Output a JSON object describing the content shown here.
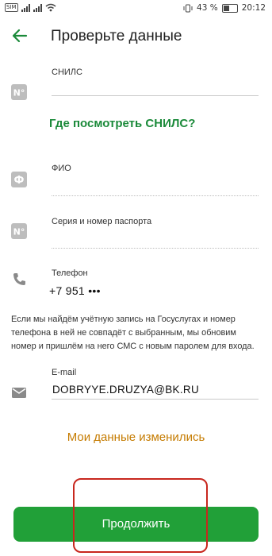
{
  "status_bar": {
    "sim_label": "SIM",
    "battery": "43 %",
    "time": "20:12"
  },
  "header": {
    "title": "Проверьте данные",
    "back_icon": "arrow-left-icon"
  },
  "fields": {
    "snils": {
      "label": "СНИЛС",
      "value": "",
      "icon": "number-sign-icon"
    },
    "fio": {
      "label": "ФИО",
      "value": "",
      "icon": "fio-icon"
    },
    "passport": {
      "label": "Серия и номер паспорта",
      "value": "",
      "icon": "number-sign-icon"
    },
    "phone": {
      "label": "Телефон",
      "value": "+7 951 •••",
      "icon": "phone-icon"
    },
    "email": {
      "label": "E-mail",
      "value": "DOBRYYE.DRUZYA@BK.RU",
      "icon": "mail-icon"
    }
  },
  "where_snils_link": "Где посмотреть СНИЛС?",
  "notice_text": "Если мы найдём учётную запись на Госуслугах и номер телефона в ней не совпадёт с выбранным, мы обновим номер и пришлём на него СМС с новым паролем для входа.",
  "data_changed_link": "Мои данные изменились",
  "continue_button": "Продолжить",
  "colors": {
    "primary_green": "#21a038",
    "link_green": "#1b8a3a",
    "link_orange": "#c57b00",
    "highlight_red": "#c8271e"
  }
}
